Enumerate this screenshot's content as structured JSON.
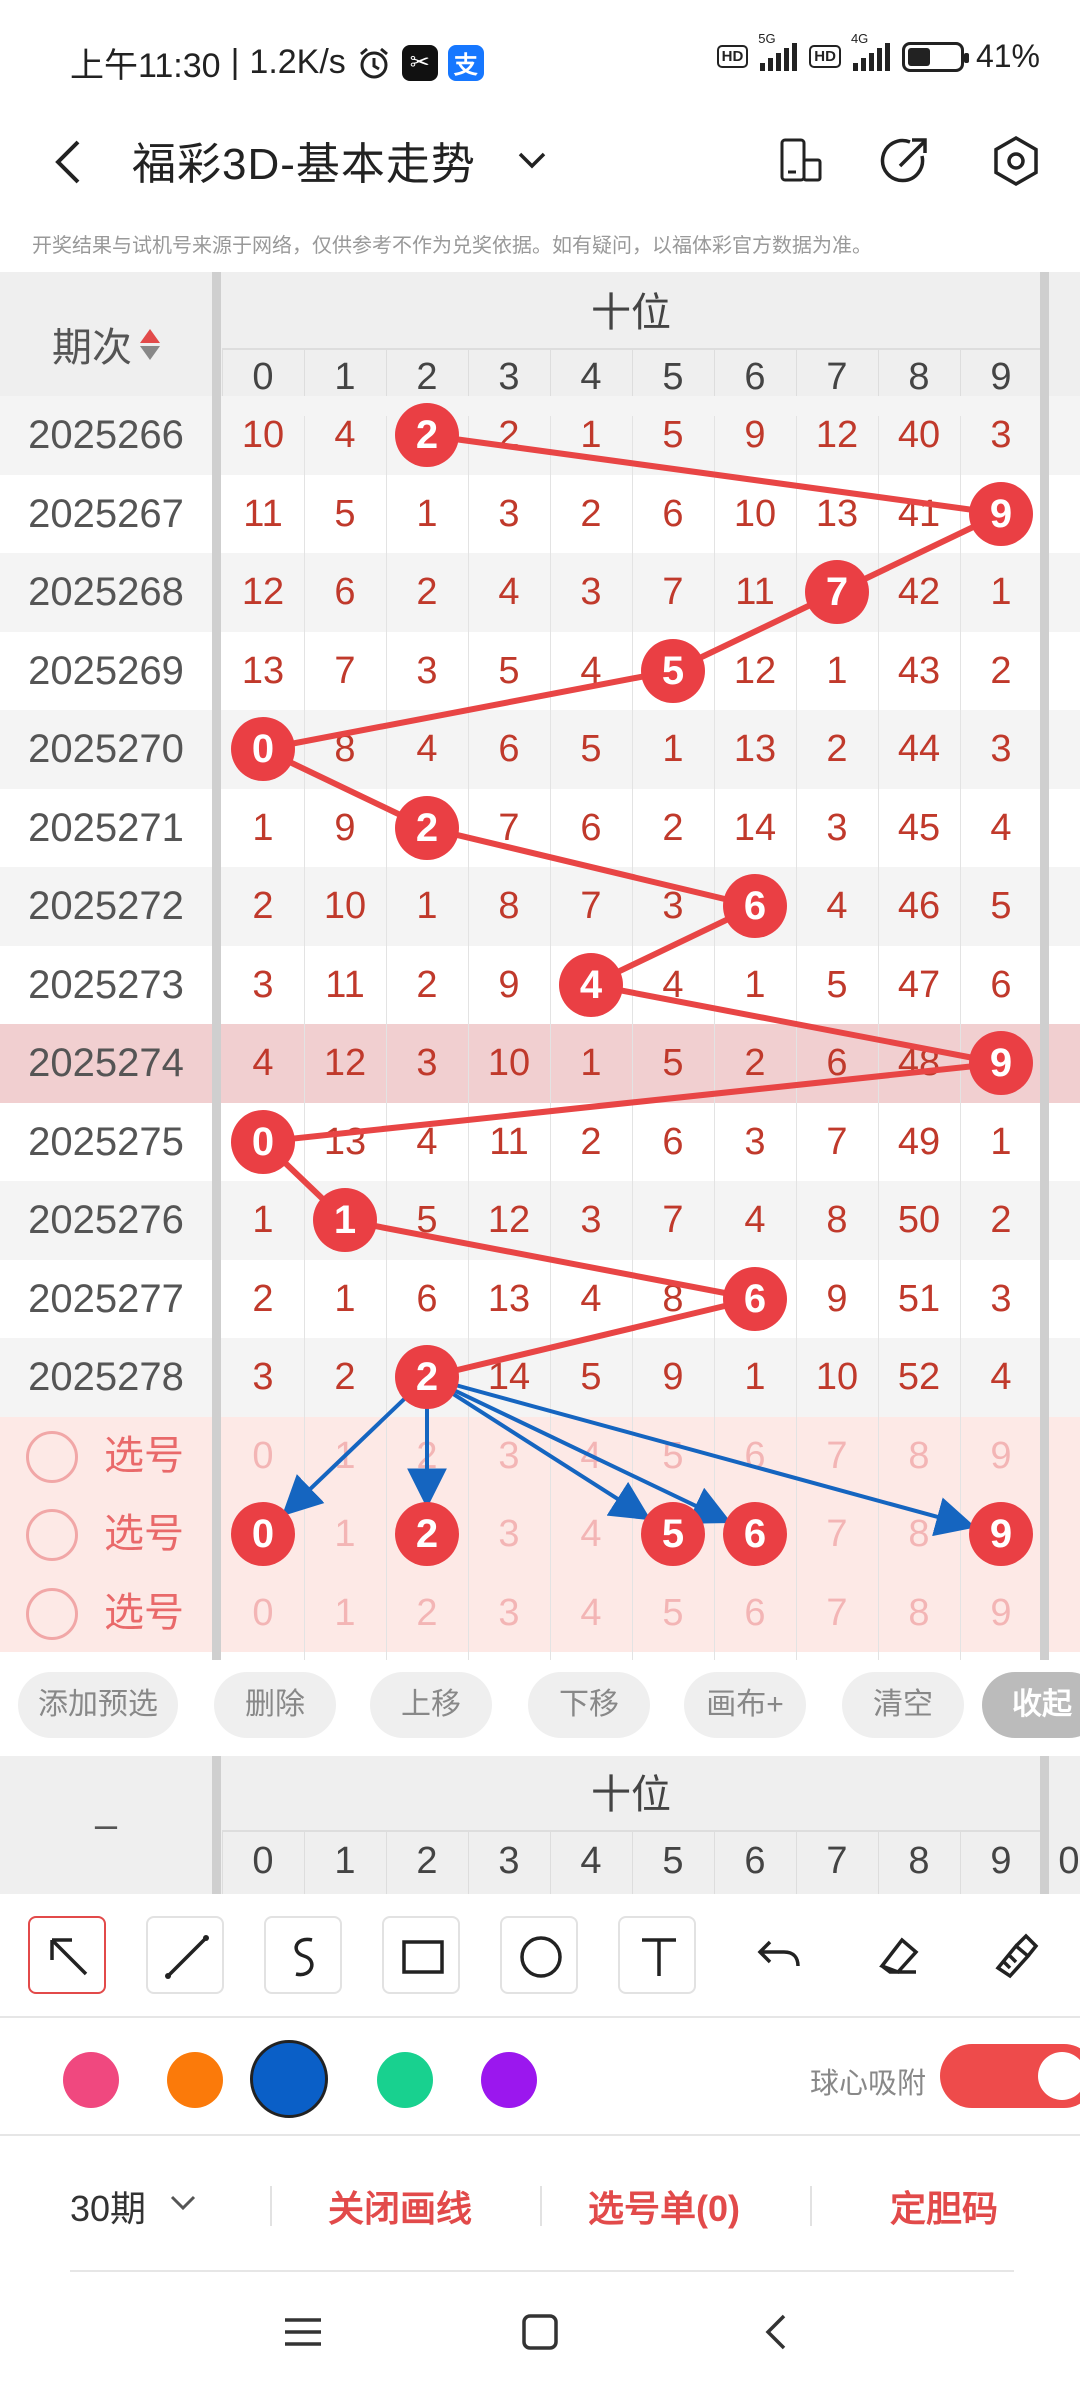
{
  "status_bar": {
    "time": "上午11:30",
    "speed": "1.2K/s",
    "alarm_icon": "alarm-icon",
    "apps": [
      "capcut-icon",
      "alipay-icon"
    ],
    "hd1": "HD",
    "net1": "5G",
    "hd2": "HD",
    "net2": "4G",
    "battery": "41%",
    "battery_level": 0.41
  },
  "header": {
    "title": "福彩3D-基本走势",
    "back_icon": "back-arrow-icon",
    "dropdown_icon": "chevron-down-icon",
    "buttons": [
      "screen-rotate-icon",
      "share-icon",
      "settings-icon"
    ]
  },
  "notice": "开奖结果与试机号来源于网络，仅供参考不作为兑奖依据。如有疑问，以福体彩官方数据为准。",
  "table": {
    "period_label": "期次",
    "group_label": "十位",
    "digits": [
      "0",
      "1",
      "2",
      "3",
      "4",
      "5",
      "6",
      "7",
      "8",
      "9"
    ],
    "next_digit_partial": "0",
    "rows": [
      {
        "period": "2025266",
        "cells": [
          "10",
          "4",
          "2",
          "2",
          "1",
          "5",
          "9",
          "12",
          "40",
          "3"
        ],
        "hit": 2,
        "partial": "9"
      },
      {
        "period": "2025267",
        "cells": [
          "11",
          "5",
          "1",
          "3",
          "2",
          "6",
          "10",
          "13",
          "41",
          "9"
        ],
        "hit": 9,
        "partial": "1"
      },
      {
        "period": "2025268",
        "cells": [
          "12",
          "6",
          "2",
          "4",
          "3",
          "7",
          "11",
          "7",
          "42",
          "1"
        ],
        "hit": 7,
        "partial": "1"
      },
      {
        "period": "2025269",
        "cells": [
          "13",
          "7",
          "3",
          "5",
          "4",
          "5",
          "12",
          "1",
          "43",
          "2"
        ],
        "hit": 5,
        "partial": "1"
      },
      {
        "period": "2025270",
        "cells": [
          "0",
          "8",
          "4",
          "6",
          "5",
          "1",
          "13",
          "2",
          "44",
          "3"
        ],
        "hit": 0,
        "partial": "1"
      },
      {
        "period": "2025271",
        "cells": [
          "1",
          "9",
          "2",
          "7",
          "6",
          "2",
          "14",
          "3",
          "45",
          "4"
        ],
        "hit": 2,
        "partial": "1"
      },
      {
        "period": "2025272",
        "cells": [
          "2",
          "10",
          "1",
          "8",
          "7",
          "3",
          "6",
          "4",
          "46",
          "5"
        ],
        "hit": 6,
        "partial": "1"
      },
      {
        "period": "2025273",
        "cells": [
          "3",
          "11",
          "2",
          "9",
          "4",
          "4",
          "1",
          "5",
          "47",
          "6"
        ],
        "hit": 4,
        "partial": "1"
      },
      {
        "period": "2025274",
        "cells": [
          "4",
          "12",
          "3",
          "10",
          "1",
          "5",
          "2",
          "6",
          "48",
          "9"
        ],
        "hit": 9,
        "partial": "1",
        "highlight": true
      },
      {
        "period": "2025275",
        "cells": [
          "0",
          "13",
          "4",
          "11",
          "2",
          "6",
          "3",
          "7",
          "49",
          "1"
        ],
        "hit": 0,
        "partial": "1"
      },
      {
        "period": "2025276",
        "cells": [
          "1",
          "1",
          "5",
          "12",
          "3",
          "7",
          "4",
          "8",
          "50",
          "2"
        ],
        "hit": 1,
        "partial": "1"
      },
      {
        "period": "2025277",
        "cells": [
          "2",
          "1",
          "6",
          "13",
          "4",
          "8",
          "6",
          "9",
          "51",
          "3"
        ],
        "hit": 6,
        "partial": "2"
      },
      {
        "period": "2025278",
        "cells": [
          "3",
          "2",
          "2",
          "14",
          "5",
          "9",
          "1",
          "10",
          "52",
          "4"
        ],
        "hit": 2,
        "partial": "2"
      }
    ],
    "pick_rows": [
      {
        "label": "选号",
        "selected": []
      },
      {
        "label": "选号",
        "selected": [
          0,
          2,
          5,
          6,
          9
        ]
      },
      {
        "label": "选号",
        "selected": []
      }
    ],
    "drawn_arrows_from": {
      "row": 12,
      "digit": 2
    },
    "drawn_arrows_to": [
      0,
      2,
      5,
      6,
      9
    ],
    "line_color": "#e84545",
    "arrow_color": "#1565c0"
  },
  "actions": [
    {
      "label": "添加预选"
    },
    {
      "label": "删除"
    },
    {
      "label": "上移"
    },
    {
      "label": "下移"
    },
    {
      "label": "画布+"
    },
    {
      "label": "清空"
    },
    {
      "label": "收起"
    }
  ],
  "second_header": {
    "dash": "–",
    "group_label": "十位",
    "digits": [
      "0",
      "1",
      "2",
      "3",
      "4",
      "5",
      "6",
      "7",
      "8",
      "9"
    ],
    "next_digit_partial": "0"
  },
  "tools": [
    "select-arrow-icon",
    "line-icon",
    "freehand-icon",
    "rectangle-icon",
    "circle-icon",
    "text-icon",
    "undo-icon",
    "eraser-icon",
    "clear-brush-icon"
  ],
  "colors": [
    "#f0487f",
    "#fb7a0a",
    "#0a5fc7",
    "#18d18f",
    "#9b17ee"
  ],
  "selected_color": "#0a5fc7",
  "adsorb_label": "球心吸附",
  "adsorb_on": true,
  "bottom": {
    "period": "30期",
    "close_lines": "关闭画线",
    "pick_list": "选号单(0)",
    "fix_code": "定胆码"
  },
  "nav": [
    "menu-icon",
    "home-icon",
    "back-icon"
  ]
}
